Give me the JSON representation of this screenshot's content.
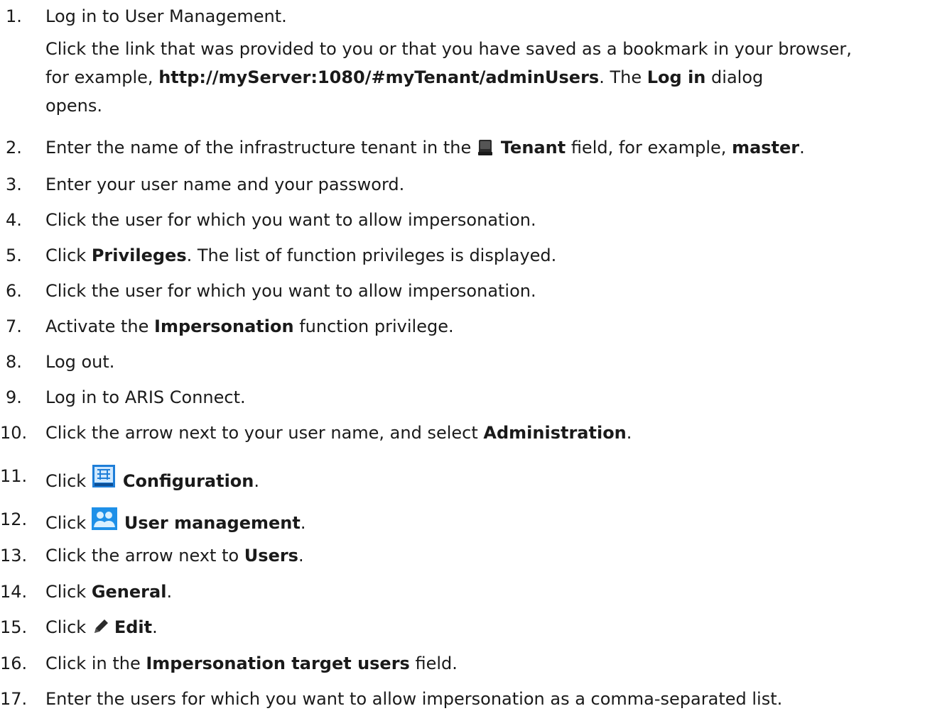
{
  "steps": [
    {
      "num": "1.",
      "text": "Log in to User Management."
    },
    {
      "num": "2.",
      "pre": "Enter the name of the infrastructure tenant in the",
      "b1": "Tenant",
      "mid": "field, for example,",
      "b2": "master",
      "post": ".",
      "icon": "database-icon"
    },
    {
      "num": "3.",
      "text": "Enter your user name and your password."
    },
    {
      "num": "4.",
      "text": "Click the user for which you want to allow impersonation."
    },
    {
      "num": "5.",
      "pre": "Click",
      "b1": "Privileges",
      "post": ". The list of function privileges is displayed."
    },
    {
      "num": "6.",
      "text": "Click the user for which you want to allow impersonation."
    },
    {
      "num": "7.",
      "pre": "Activate the",
      "b1": "Impersonation",
      "post": "function privilege."
    },
    {
      "num": "8.",
      "text": "Log out."
    },
    {
      "num": "9.",
      "text": "Log in to ARIS Connect."
    },
    {
      "num": "10.",
      "pre": "Click the arrow next to your user name, and select",
      "b1": "Administration",
      "post": "."
    },
    {
      "num": "11.",
      "pre": "Click",
      "b1": "Configuration",
      "post": ".",
      "icon": "configuration-icon"
    },
    {
      "num": "12.",
      "pre": "Click",
      "b1": "User management",
      "post": ".",
      "icon": "user-management-icon"
    },
    {
      "num": "13.",
      "pre": "Click the arrow next to",
      "b1": "Users",
      "post": "."
    },
    {
      "num": "14.",
      "pre": "Click",
      "b1": "General",
      "post": "."
    },
    {
      "num": "15.",
      "pre": "Click",
      "b1": "Edit",
      "post": ".",
      "icon": "pencil-icon"
    },
    {
      "num": "16.",
      "pre": "Click in the",
      "b1": "Impersonation target users",
      "post": "field."
    },
    {
      "num": "17.",
      "text": "Enter the users for which you want to allow impersonation as a comma-separated list."
    }
  ],
  "step1_detail": {
    "pre": "Click the link that was provided to you or that you have saved as a bookmark in your browser,",
    "line2_pre": "for example,",
    "url": "http://myServer:1080/#myTenant/adminUsers",
    "line2_mid": ". The",
    "dialog": "Log in",
    "line2_post": "dialog",
    "line3": "opens."
  }
}
